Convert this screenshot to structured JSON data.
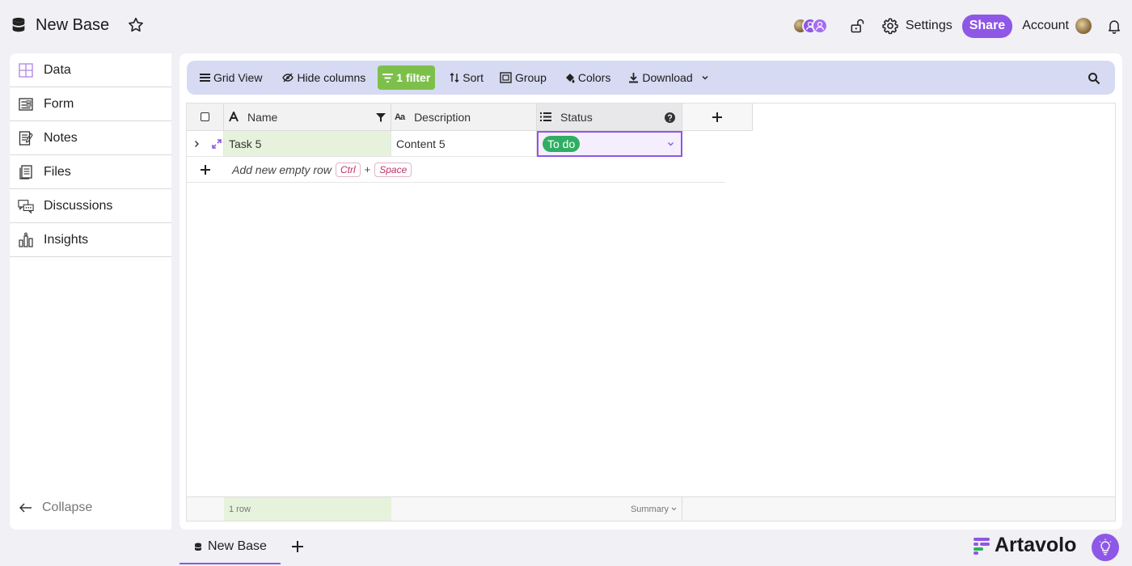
{
  "header": {
    "title": "New Base",
    "settings_label": "Settings",
    "share_label": "Share",
    "account_label": "Account"
  },
  "sidebar": {
    "items": [
      {
        "label": "Data",
        "icon": "grid-icon"
      },
      {
        "label": "Form",
        "icon": "form-icon"
      },
      {
        "label": "Notes",
        "icon": "notes-icon"
      },
      {
        "label": "Files",
        "icon": "files-icon"
      },
      {
        "label": "Discussions",
        "icon": "discussions-icon"
      },
      {
        "label": "Insights",
        "icon": "insights-icon"
      }
    ],
    "collapse_label": "Collapse"
  },
  "toolbar": {
    "grid_view": "Grid View",
    "hide_columns": "Hide columns",
    "filter": "1 filter",
    "sort": "Sort",
    "group": "Group",
    "colors": "Colors",
    "download": "Download"
  },
  "grid": {
    "columns": [
      {
        "label": "Name"
      },
      {
        "label": "Description"
      },
      {
        "label": "Status"
      }
    ],
    "rows": [
      {
        "name": "Task 5",
        "description": "Content 5",
        "status": "To do"
      }
    ],
    "add_row_label": "Add new empty row",
    "shortcut_ctrl": "Ctrl",
    "shortcut_plus": "+",
    "shortcut_space": "Space",
    "footer_count": "1 row",
    "footer_summary": "Summary"
  },
  "bottom": {
    "tab_label": "New Base",
    "brand": "Artavolo"
  },
  "colors": {
    "accent": "#8e57e6",
    "filter_green": "#7cc04b",
    "status_green": "#2fae63",
    "name_col_bg": "#e7f2dc",
    "toolbar_bg": "#d6daf2"
  }
}
